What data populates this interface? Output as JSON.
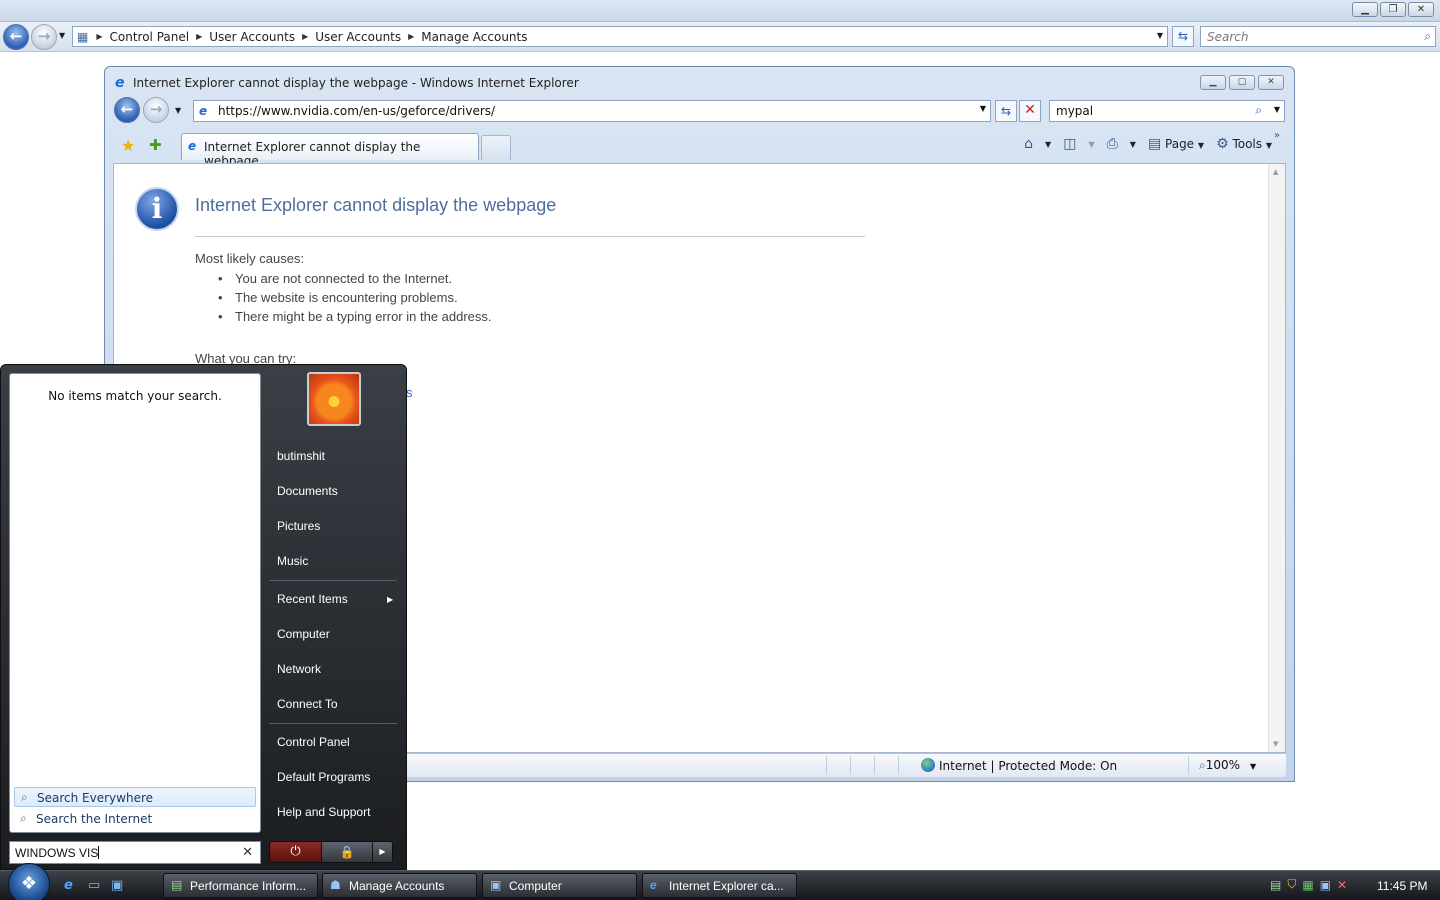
{
  "control_panel": {
    "breadcrumbs": [
      "Control Panel",
      "User Accounts",
      "User Accounts",
      "Manage Accounts"
    ],
    "search_placeholder": "Search"
  },
  "ie": {
    "window_title": "Internet Explorer cannot display the webpage - Windows Internet Explorer",
    "address": "https://www.nvidia.com/en-us/geforce/drivers/",
    "search_value": "mypal",
    "tab_label": "Internet Explorer cannot display the webpage",
    "commands": {
      "page": "Page",
      "tools": "Tools"
    },
    "page": {
      "title": "Internet Explorer cannot display the webpage",
      "causes_heading": "Most likely causes:",
      "causes": [
        "You are not connected to the Internet.",
        "The website is encountering problems.",
        "There might be a typing error in the address."
      ],
      "try_heading": "What you can try:",
      "link_fragment": "s"
    },
    "status": {
      "zone": "Internet | Protected Mode: On",
      "zoom": "100%"
    }
  },
  "start_menu": {
    "no_results": "No items match your search.",
    "search_options": [
      "Search Everywhere",
      "Search the Internet"
    ],
    "search_text": "WINDOWS VIS",
    "right_items": [
      "butimshit",
      "Documents",
      "Pictures",
      "Music",
      "Recent Items",
      "Computer",
      "Network",
      "Connect To",
      "Control Panel",
      "Default Programs",
      "Help and Support"
    ]
  },
  "taskbar": {
    "tasks": [
      "Performance Inform...",
      "Manage Accounts",
      "Computer",
      "Internet Explorer ca..."
    ],
    "clock": "11:45 PM"
  }
}
